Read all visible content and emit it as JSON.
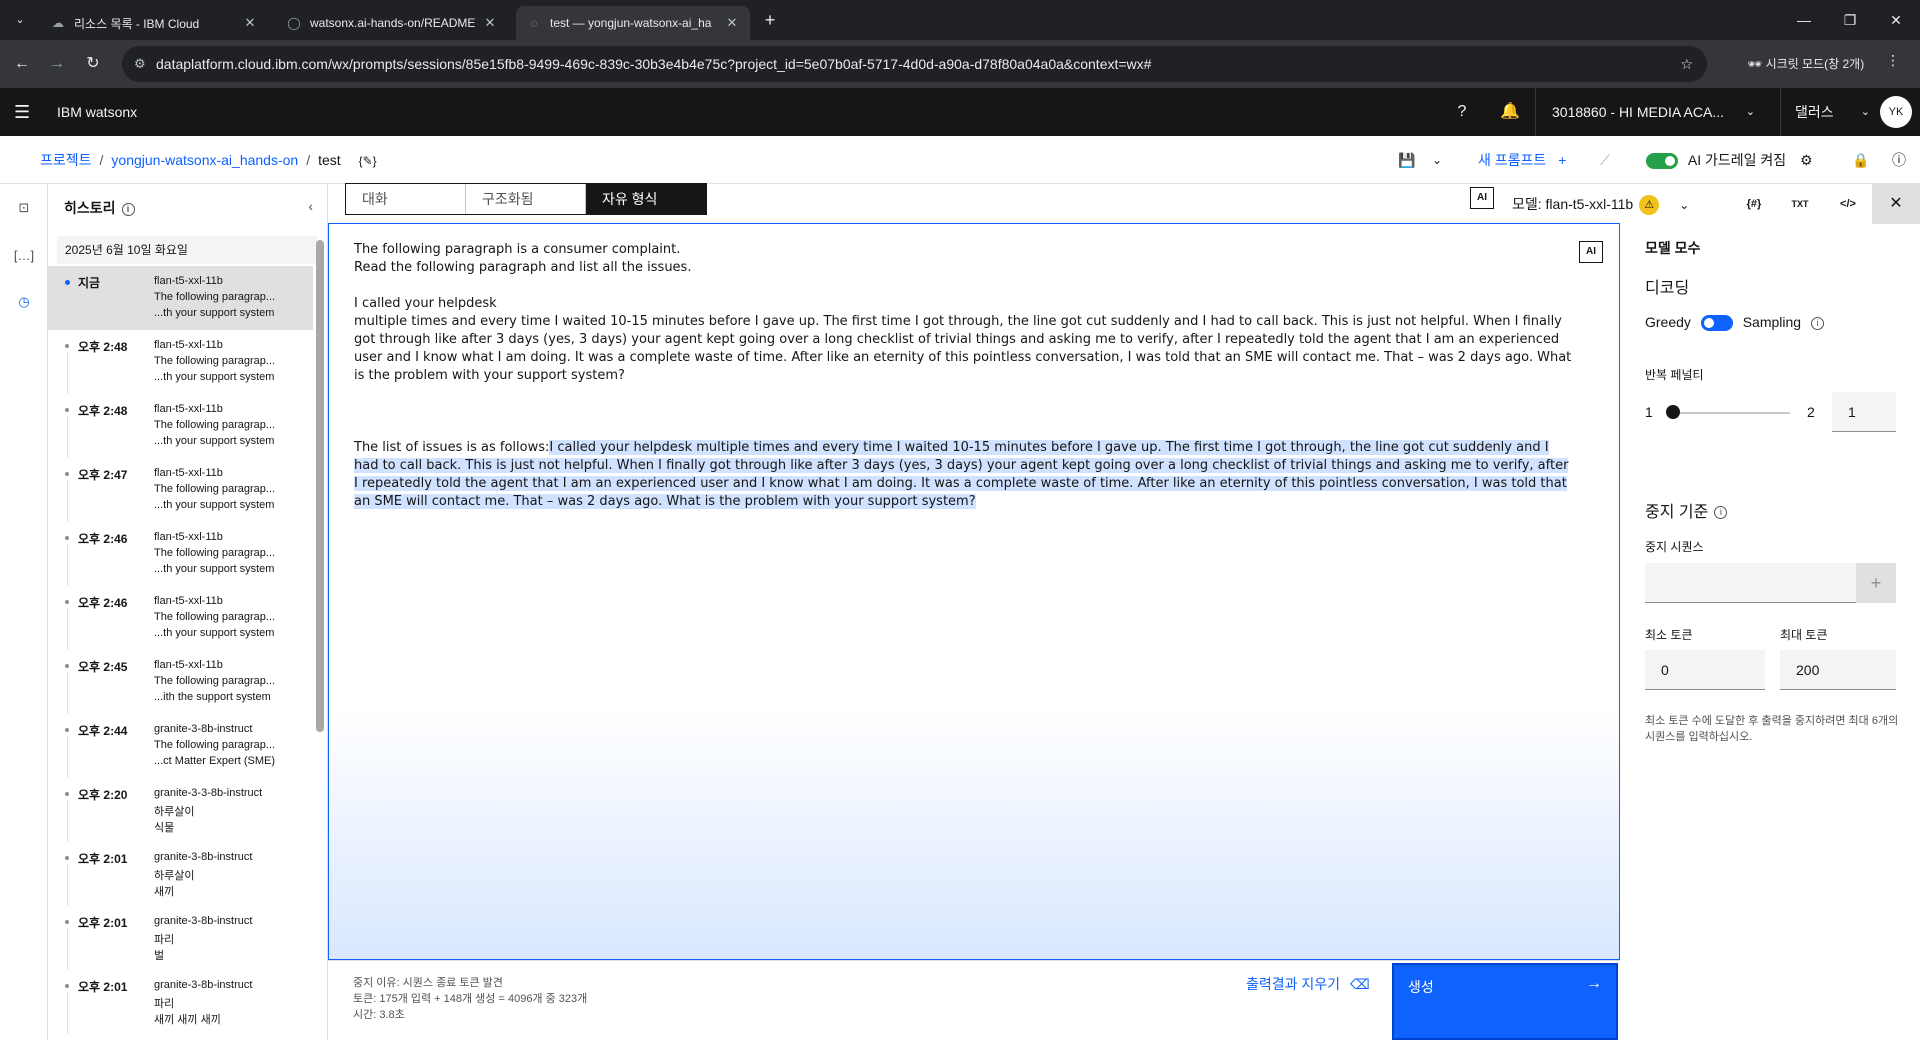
{
  "browser": {
    "tabs": [
      {
        "title": "리소스 목록 - IBM Cloud"
      },
      {
        "title": "watsonx.ai-hands-on/README"
      },
      {
        "title": "test — yongjun-watsonx-ai_ha"
      }
    ],
    "new_tab": "+",
    "url": "dataplatform.cloud.ibm.com/wx/prompts/sessions/85e15fb8-9499-469c-839c-30b3e4b4e75c?project_id=5e07b0af-5717-4d0d-a90a-d78f80a04a0a&context=wx#",
    "incognito_label": "시크릿 모드(창 2개)"
  },
  "app": {
    "brand": "IBM watsonx",
    "account": "3018860 - HI MEDIA ACA...",
    "region": "댈러스",
    "avatar": "YK"
  },
  "breadcrumb": {
    "project": "프로젝트",
    "project_name": "yongjun-watsonx-ai_hands-on",
    "current": "test"
  },
  "toolbar": {
    "new_prompt": "새 프롬프트",
    "guardrail": "AI 가드레일 켜짐"
  },
  "history": {
    "title": "히스토리",
    "date": "2025년 6월 10일 화요일",
    "items": [
      {
        "time": "지금",
        "model": "flan-t5-xxl-11b",
        "line1": "The following paragrap...",
        "line2": "...th your support system"
      },
      {
        "time": "오후 2:48",
        "model": "flan-t5-xxl-11b",
        "line1": "The following paragrap...",
        "line2": "...th your support system"
      },
      {
        "time": "오후 2:48",
        "model": "flan-t5-xxl-11b",
        "line1": "The following paragrap...",
        "line2": "...th your support system"
      },
      {
        "time": "오후 2:47",
        "model": "flan-t5-xxl-11b",
        "line1": "The following paragrap...",
        "line2": "...th your support system"
      },
      {
        "time": "오후 2:46",
        "model": "flan-t5-xxl-11b",
        "line1": "The following paragrap...",
        "line2": "...th your support system"
      },
      {
        "time": "오후 2:46",
        "model": "flan-t5-xxl-11b",
        "line1": "The following paragrap...",
        "line2": "...th your support system"
      },
      {
        "time": "오후 2:45",
        "model": "flan-t5-xxl-11b",
        "line1": "The following paragrap...",
        "line2": "...ith the support system"
      },
      {
        "time": "오후 2:44",
        "model": "granite-3-8b-instruct",
        "line1": "The following paragrap...",
        "line2": "...ct Matter Expert (SME)"
      },
      {
        "time": "오후 2:20",
        "model": "granite-3-3-8b-instruct",
        "line1": "하루살이",
        "line2": "식물"
      },
      {
        "time": "오후 2:01",
        "model": "granite-3-8b-instruct",
        "line1": "하루살이",
        "line2": "새끼"
      },
      {
        "time": "오후 2:01",
        "model": "granite-3-8b-instruct",
        "line1": "파리",
        "line2": "벌"
      },
      {
        "time": "오후 2:01",
        "model": "granite-3-8b-instruct",
        "line1": "파리",
        "line2": "새끼 새끼 새끼"
      }
    ]
  },
  "modes": {
    "chat": "대화",
    "structured": "구조화됨",
    "freeform": "자유 형식"
  },
  "model": {
    "ai_badge": "AI",
    "label": "모델: flan-t5-xxl-11b",
    "warning": "⚠",
    "txt_icon": "TXT"
  },
  "editor": {
    "p1": "The following paragraph is a consumer complaint.",
    "p2": "Read the following paragraph and list all the issues.",
    "p3": "I called your helpdesk",
    "p4": "multiple times and every time I waited 10-15 minutes before I gave up. The first time I got through, the line got cut suddenly and I had to call back. This is just not helpful. When I finally got through like after 3 days (yes, 3 days) your agent kept going over a long checklist of trivial things and asking me to verify, after I repeatedly told the agent that I am an experienced user and I know what I am doing. It was a complete waste of time. After like an eternity of this pointless conversation, I was told that an SME will contact me. That – was 2 days ago. What is the problem with your support system?",
    "output_prefix": "The list of issues is as follows:",
    "output": "I called your helpdesk multiple times and every time I waited 10-15 minutes before I gave up. The first time I got through, the line got cut suddenly and I had to call back. This is just not helpful. When I finally got through like after 3 days (yes, 3 days) your agent kept going over a long checklist of trivial things and asking me to verify, after I repeatedly told the agent that I am an experienced user and I know what I am doing. It was a complete waste of time. After like an eternity of this pointless conversation, I was told that an SME will contact me. That – was 2 days ago. What is the problem with your support system?"
  },
  "footer": {
    "stop_reason": "중지 이유: 시퀀스 종료 토큰 발견",
    "tokens": "토큰: 175개 입력 + 148개 생성 = 4096개 중 323개",
    "time": "시간: 3.8초",
    "clear": "출력결과 지우기",
    "generate": "생성"
  },
  "params": {
    "title": "모델 모수",
    "decoding": "디코딩",
    "greedy": "Greedy",
    "sampling": "Sampling",
    "repetition_penalty": "반복 페널티",
    "rp_min": "1",
    "rp_max": "2",
    "rp_value": "1",
    "stop_criteria": "중지 기준",
    "stop_sequence": "중지 시퀀스",
    "stop_sequence_value": "",
    "min_tokens_label": "최소 토큰",
    "max_tokens_label": "최대 토큰",
    "min_tokens": "0",
    "max_tokens": "200",
    "help": "최소 토큰 수에 도달한 후 출력을 중지하려면 최대 6개의 시퀀스를 입력하십시오."
  }
}
